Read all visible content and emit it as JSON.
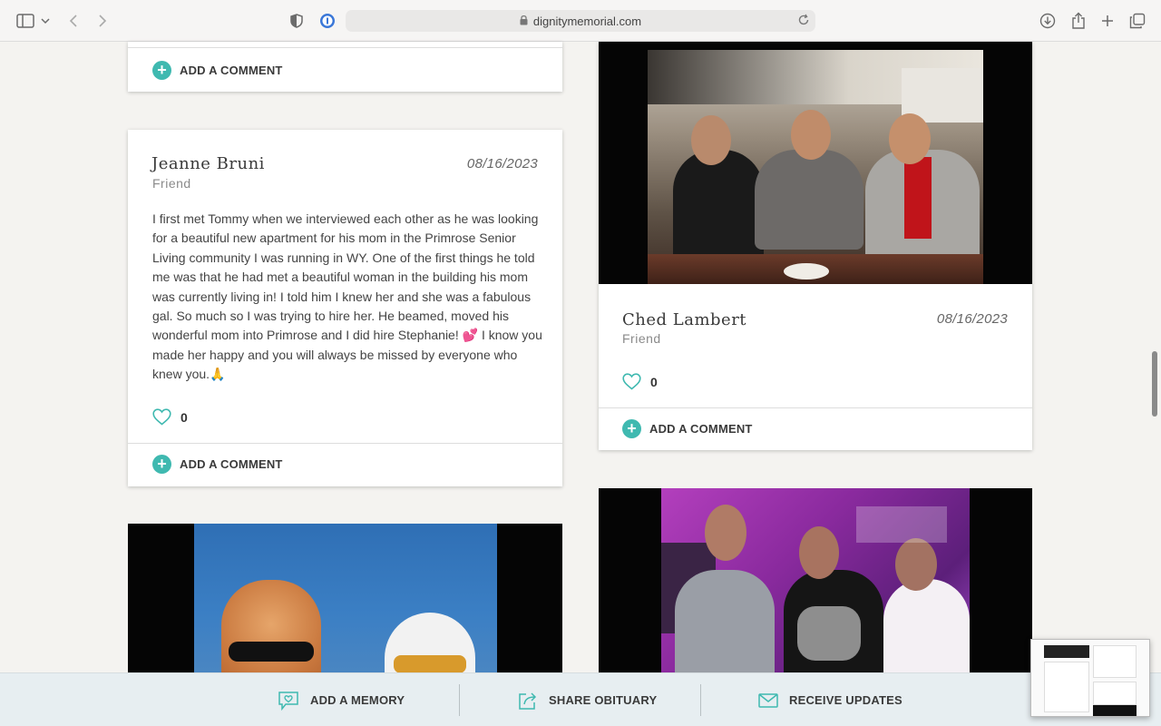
{
  "browser": {
    "url": "dignitymemorial.com"
  },
  "cards": {
    "top_left": {
      "comment_label": "ADD A COMMENT"
    },
    "jeanne": {
      "name": "Jeanne Bruni",
      "relation": "Friend",
      "date": "08/16/2023",
      "text": "I first met Tommy when we interviewed each other as he was looking for a beautiful new apartment for his mom in the Primrose Senior Living community I was running in WY. One of the first things he told me was that he had met a beautiful woman in the building his mom was currently living in! I told him I knew her and she was a fabulous gal. So much so I was trying to hire her. He beamed, moved his wonderful mom into Primrose and I did hire Stephanie! 💕 I know you made her happy and you will always be missed by everyone who knew you.🙏",
      "likes": "0",
      "comment_label": "ADD A COMMENT"
    },
    "ched": {
      "name": "Ched Lambert",
      "relation": "Friend",
      "date": "08/16/2023",
      "likes": "0",
      "comment_label": "ADD A COMMENT"
    }
  },
  "actionbar": {
    "add_memory": "ADD A MEMORY",
    "share_obituary": "SHARE OBITUARY",
    "receive_updates": "RECEIVE UPDATES"
  },
  "colors": {
    "accent": "#3fb9b0",
    "page_bg": "#f4f3f0",
    "action_bar_bg": "#e7eef1"
  }
}
